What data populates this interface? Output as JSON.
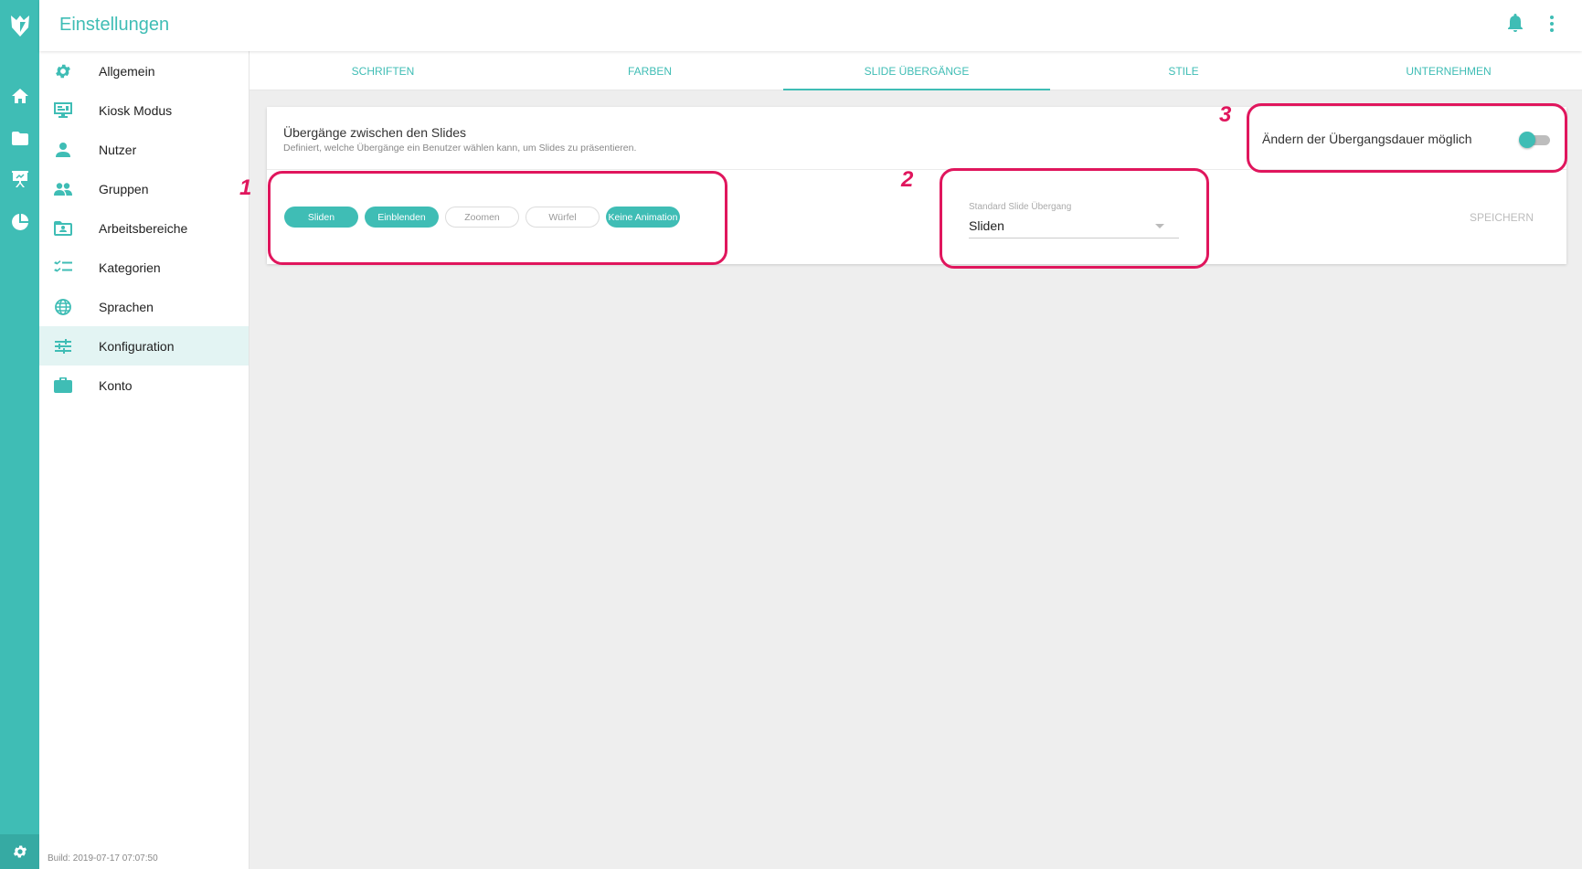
{
  "header": {
    "title": "Einstellungen"
  },
  "sidebar": {
    "items": [
      {
        "label": "Allgemein"
      },
      {
        "label": "Kiosk Modus"
      },
      {
        "label": "Nutzer"
      },
      {
        "label": "Gruppen"
      },
      {
        "label": "Arbeitsbereiche"
      },
      {
        "label": "Kategorien"
      },
      {
        "label": "Sprachen"
      },
      {
        "label": "Konfiguration",
        "active": true
      },
      {
        "label": "Konto"
      }
    ],
    "build": "Build: 2019-07-17 07:07:50"
  },
  "tabs": [
    {
      "label": "SCHRIFTEN"
    },
    {
      "label": "FARBEN"
    },
    {
      "label": "SLIDE ÜBERGÄNGE",
      "active": true
    },
    {
      "label": "STILE"
    },
    {
      "label": "UNTERNEHMEN"
    }
  ],
  "transitions": {
    "title": "Übergänge zwischen den Slides",
    "description": "Definiert, welche Übergänge ein Benutzer wählen kann, um Slides zu präsentieren.",
    "toggle_label": "Ändern der Übergangsdauer möglich",
    "toggle_on": false,
    "chips": [
      {
        "label": "Sliden",
        "selected": true
      },
      {
        "label": "Einblenden",
        "selected": true
      },
      {
        "label": "Zoomen",
        "selected": false
      },
      {
        "label": "Würfel",
        "selected": false
      },
      {
        "label": "Keine Animation",
        "selected": true
      }
    ],
    "default_select": {
      "label": "Standard Slide Übergang",
      "value": "Sliden"
    },
    "save_label": "SPEICHERN"
  },
  "annotations": {
    "one": "1",
    "two": "2",
    "three": "3"
  },
  "colors": {
    "accent": "#3fbdb5",
    "highlight": "#e0165d"
  }
}
